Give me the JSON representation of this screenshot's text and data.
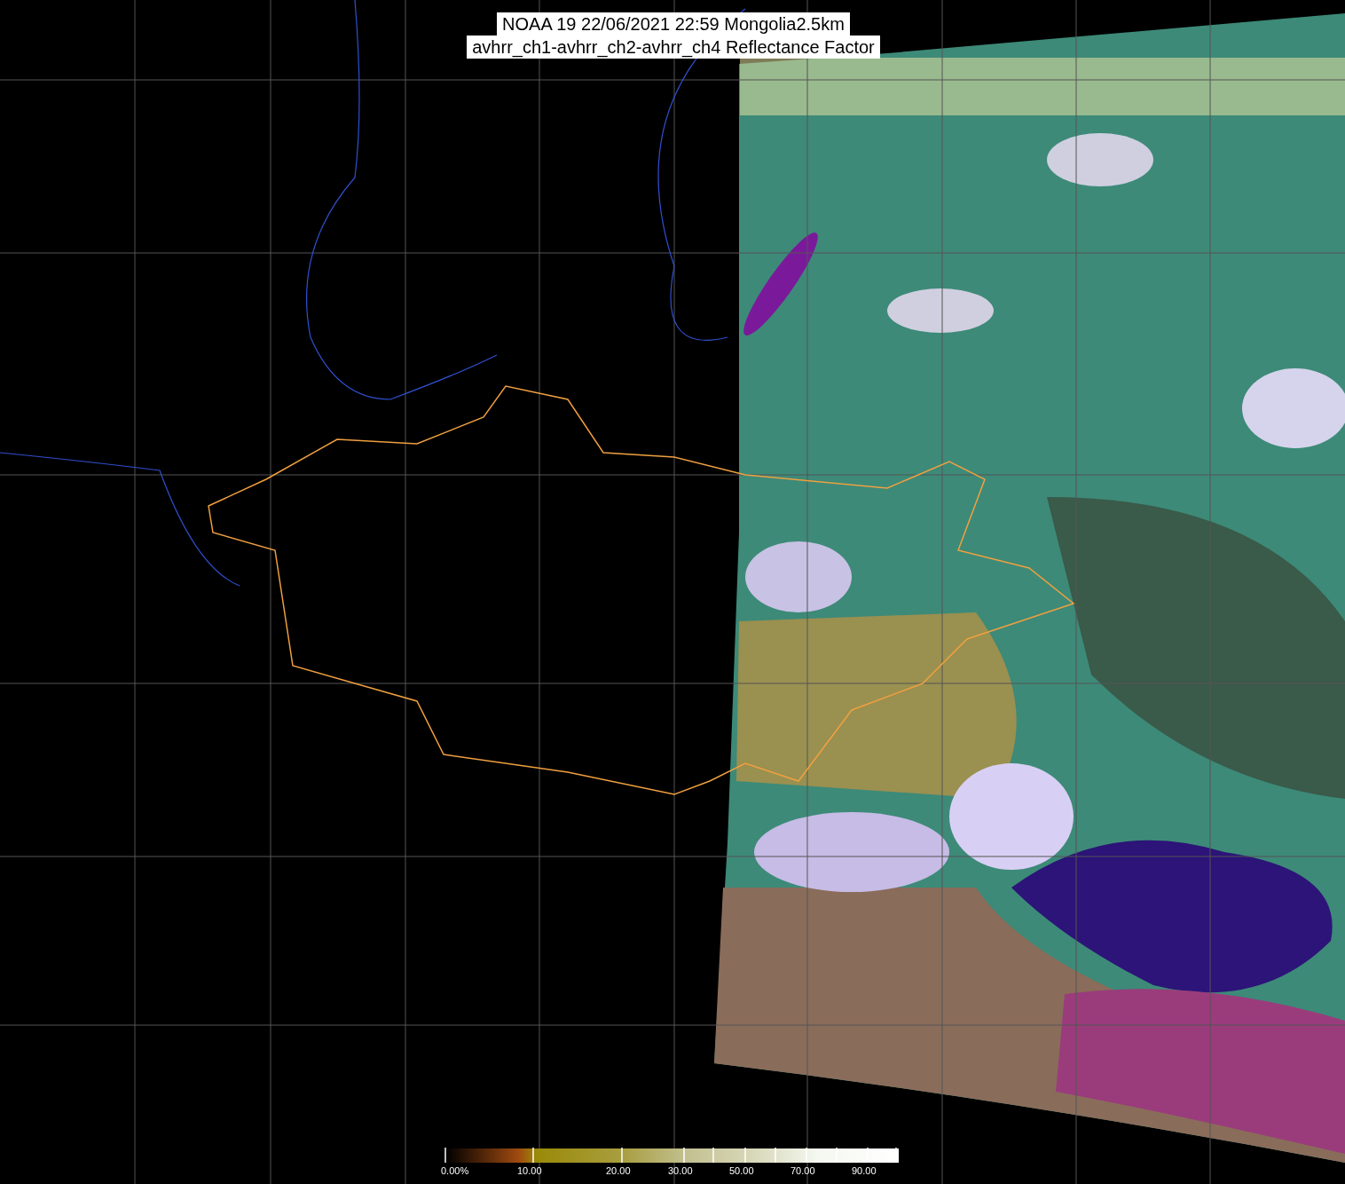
{
  "title": {
    "line_1": "NOAA 19 22/06/2021 22:59 Mongolia2.5km",
    "line_2": "avhrr_ch1-avhrr_ch2-avhrr_ch4 Reflectance Factor"
  },
  "color_scale": {
    "labels": [
      "0.00%",
      "10.00",
      "20.00",
      "30.00",
      "50.00",
      "70.00",
      "90.00"
    ]
  }
}
